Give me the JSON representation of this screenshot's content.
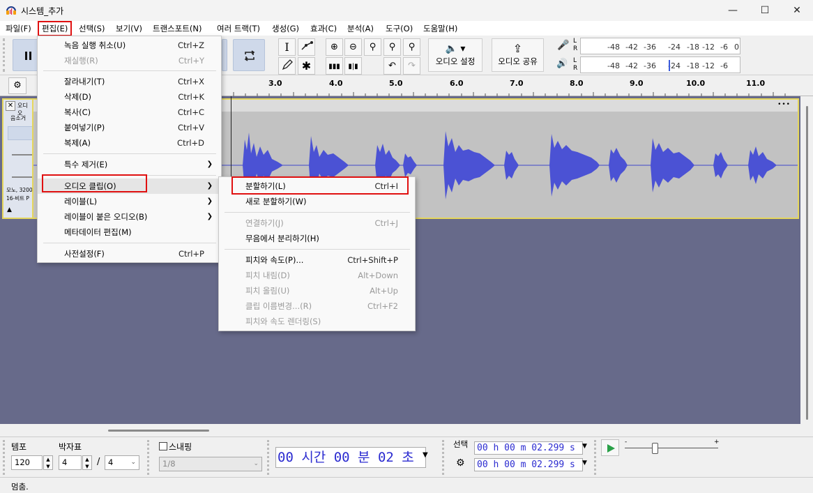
{
  "window": {
    "title": "시스템_추가"
  },
  "menubar": [
    {
      "label": "파일(F)"
    },
    {
      "label": "편집(E)"
    },
    {
      "label": "선택(S)"
    },
    {
      "label": "보기(V)"
    },
    {
      "label": "트랜스포트(N)"
    },
    {
      "label": "여러 트랙(T)"
    },
    {
      "label": "생성(G)"
    },
    {
      "label": "효과(C)"
    },
    {
      "label": "분석(A)"
    },
    {
      "label": "도구(O)"
    },
    {
      "label": "도움말(H)"
    }
  ],
  "toolbar": {
    "audio_setup": "오디오 설정",
    "audio_share": "오디오 공유",
    "meter_lr": [
      "L",
      "R"
    ],
    "meter_scale": [
      "-48",
      "-42",
      "-36",
      "-24",
      "-18",
      "-12",
      "-6",
      "0"
    ]
  },
  "ruler": {
    "ticks": [
      "3.0",
      "4.0",
      "5.0",
      "6.0",
      "7.0",
      "8.0",
      "9.0",
      "10.0",
      "11.0"
    ]
  },
  "track": {
    "name": "오디오",
    "mute": "음소거",
    "info1": "모노, 3200",
    "info2": "16-비트 P",
    "menu_dots": "•••"
  },
  "edit_menu": [
    {
      "label": "녹음 실행 취소(U)",
      "shortcut": "Ctrl+Z"
    },
    {
      "label": "재실행(R)",
      "shortcut": "Ctrl+Y"
    },
    {
      "label": "잘라내기(T)",
      "shortcut": "Ctrl+X"
    },
    {
      "label": "삭제(D)",
      "shortcut": "Ctrl+K"
    },
    {
      "label": "복사(C)",
      "shortcut": "Ctrl+C"
    },
    {
      "label": "붙여넣기(P)",
      "shortcut": "Ctrl+V"
    },
    {
      "label": "복제(A)",
      "shortcut": "Ctrl+D"
    },
    {
      "label": "특수 제거(E)",
      "shortcut": ""
    },
    {
      "label": "오디오 클립(O)",
      "shortcut": ""
    },
    {
      "label": "레이블(L)",
      "shortcut": ""
    },
    {
      "label": "레이블이 붙은 오디오(B)",
      "shortcut": ""
    },
    {
      "label": "메타데이터 편집(M)",
      "shortcut": ""
    },
    {
      "label": "사전설정(F)",
      "shortcut": "Ctrl+P"
    }
  ],
  "clip_menu": [
    {
      "label": "분할하기(L)",
      "shortcut": "Ctrl+I"
    },
    {
      "label": "새로 분할하기(W)",
      "shortcut": ""
    },
    {
      "label": "연결하기(J)",
      "shortcut": "Ctrl+J"
    },
    {
      "label": "무음에서 분리하기(H)",
      "shortcut": ""
    },
    {
      "label": "피치와 속도(P)...",
      "shortcut": "Ctrl+Shift+P"
    },
    {
      "label": "피치 내림(D)",
      "shortcut": "Alt+Down"
    },
    {
      "label": "피치 올림(U)",
      "shortcut": "Alt+Up"
    },
    {
      "label": "클립 이름변경...(R)",
      "shortcut": "Ctrl+F2"
    },
    {
      "label": "피치와 속도 렌더링(S)",
      "shortcut": ""
    }
  ],
  "bottom": {
    "tempo_label": "템포",
    "tempo_value": "120",
    "timesig_label": "박자표",
    "ts_num": "4",
    "ts_slash": "/",
    "ts_den": "4",
    "snap_label": "스내핑",
    "snap_value": "1/8",
    "time": "00 시간 00 분 02 초",
    "selection_label": "선택",
    "sel_start": "00 h 00 m 02.299 s",
    "sel_end": "00 h 00 m 02.299 s",
    "play_minus": "-",
    "play_plus": "+"
  },
  "status": {
    "text": "멈춤."
  }
}
